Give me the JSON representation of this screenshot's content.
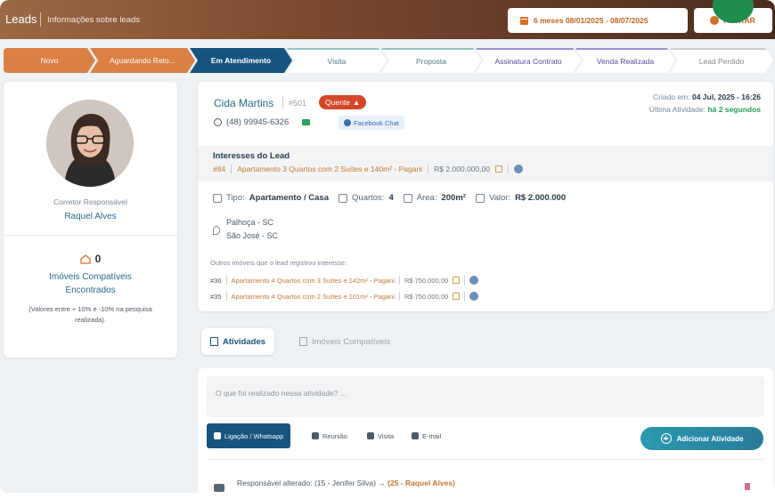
{
  "header": {
    "brand": "Leads",
    "subtitle": "Informações sobre leads",
    "period_label": "6 meses 08/01/2025 - 08/07/2025",
    "filter_label": "FILTRAR"
  },
  "pipeline": {
    "stages": [
      {
        "label": "Novo",
        "state": "done"
      },
      {
        "label": "Aguardando Reto...",
        "state": "done"
      },
      {
        "label": "Em Atendimento",
        "state": "active"
      },
      {
        "label": "Visita",
        "state": "pending"
      },
      {
        "label": "Proposta",
        "state": "pending"
      },
      {
        "label": "Assinatura Contrato",
        "state": "pending"
      },
      {
        "label": "Venda Realizada",
        "state": "pending"
      },
      {
        "label": "Lead Perdido",
        "state": "pending"
      }
    ]
  },
  "agent": {
    "label": "Corretor Responsável",
    "name": "Raquel Alves"
  },
  "compatible": {
    "count": "0",
    "label_line1": "Imóveis Compatíveis",
    "label_line2": "Encontrados",
    "note": "(Valores entre + 10% e -10% na pesquisa realizada)."
  },
  "lead": {
    "name": "Cida Martins",
    "id": "#501",
    "temperature": "Quente",
    "phone": "(48) 99945-6326",
    "source": "Facebook Chat",
    "created_label": "Criado em:",
    "created_value": "04 Jul, 2025 - 16:26",
    "last_activity_label": "Última Atividade:",
    "last_activity_value": "há 2 segundos"
  },
  "interest": {
    "title": "Interesses do Lead",
    "code": "#84",
    "property": "Apartamento 3 Quartos com 2 Suítes e 140m² - Pagani",
    "price": "R$ 2.000.000,00"
  },
  "specs": {
    "type_label": "Tipo:",
    "type_value": "Apartamento / Casa",
    "rooms_label": "Quartos:",
    "rooms_value": "4",
    "area_label": "Área:",
    "area_value": "200m²",
    "value_label": "Valor:",
    "value_value": "R$ 2.000.000"
  },
  "locations": [
    "Palhoça - SC",
    "São José - SC"
  ],
  "others": {
    "title": "Outros imóveis que o lead registrou interesse:",
    "items": [
      {
        "code": "#36",
        "property": "Apartamento 4 Quartos com 3 Suítes e 142m² - Pagani",
        "price": "R$ 750.000,00"
      },
      {
        "code": "#35",
        "property": "Apartamento 4 Quartos com 2 Suítes e 101m² - Pagani",
        "price": "R$ 750.000,00"
      }
    ]
  },
  "tabs": {
    "activities": "Atividades",
    "compatible": "Imóveis Compatíveis"
  },
  "activity": {
    "placeholder": "O que foi realizado nessa atividade? ...",
    "types": [
      "Ligação / Whatsapp",
      "Reunião",
      "Visita",
      "E-mail"
    ],
    "add_label": "Adicionar Atividade",
    "log_prefix": "Responsável alterado: (15 - Jenifer Silva) →",
    "log_new": "(25 - Raquel Alves)"
  },
  "colors": {
    "accent_orange": "#d98045",
    "accent_blue": "#17547e",
    "hot_red": "#d4462a",
    "online_green": "#2a9a5a"
  }
}
